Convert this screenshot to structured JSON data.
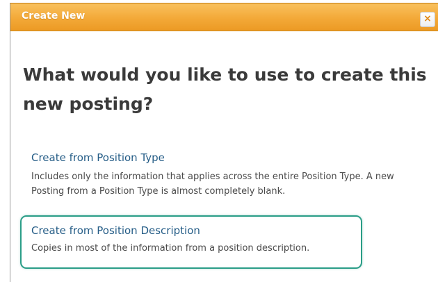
{
  "dialog": {
    "title": "Create New",
    "close_glyph": "×",
    "headline": "What would you like to use to create this new posting?"
  },
  "options": [
    {
      "label": "Create from Position Type",
      "description": "Includes only the information that applies across the entire Position Type. A new Posting from a Position Type is almost completely blank."
    },
    {
      "label": "Create from Position Description",
      "description": "Copies in most of the information from a position description."
    }
  ],
  "colors": {
    "titlebar": "#f3a938",
    "link": "#245c86",
    "highlight_border": "#2a9d87",
    "headline": "#3a3a3a"
  },
  "icons": {
    "close": "close-icon"
  }
}
